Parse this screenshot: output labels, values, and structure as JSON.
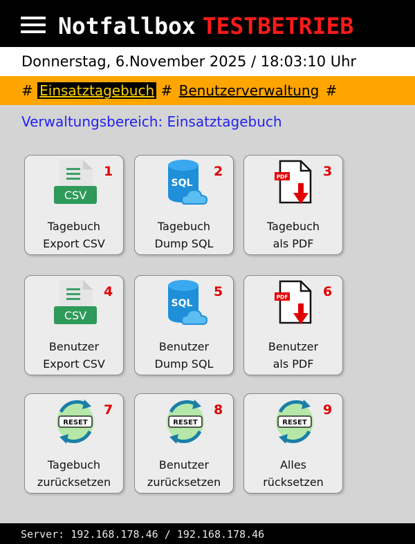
{
  "header": {
    "app_title": "Notfallbox",
    "mode_badge": "TESTBETRIEB"
  },
  "datebar": {
    "datetime": "Donnerstag, 6.November 2025 / 18:03:10 Uhr"
  },
  "nav": {
    "sep": "#",
    "items": [
      {
        "label": "Einsatztagebuch",
        "active": true
      },
      {
        "label": "Benutzerverwaltung",
        "active": false
      }
    ]
  },
  "area_title": "Verwaltungsbereich: Einsatztagebuch",
  "tiles": [
    {
      "num": "1",
      "icon": "csv-file-icon",
      "label": "Tagebuch\nExport CSV",
      "icon_text": "CSV"
    },
    {
      "num": "2",
      "icon": "sql-database-icon",
      "label": "Tagebuch\nDump SQL",
      "icon_text": "SQL"
    },
    {
      "num": "3",
      "icon": "pdf-download-icon",
      "label": "Tagebuch\nals PDF",
      "icon_text": "PDF"
    },
    {
      "num": "4",
      "icon": "csv-file-icon",
      "label": "Benutzer\nExport CSV",
      "icon_text": "CSV"
    },
    {
      "num": "5",
      "icon": "sql-database-icon",
      "label": "Benutzer\nDump SQL",
      "icon_text": "SQL"
    },
    {
      "num": "6",
      "icon": "pdf-download-icon",
      "label": "Benutzer\nals PDF",
      "icon_text": "PDF"
    },
    {
      "num": "7",
      "icon": "reset-icon",
      "label": "Tagebuch\nzurücksetzen",
      "icon_text": "RESET"
    },
    {
      "num": "8",
      "icon": "reset-icon",
      "label": "Benutzer\nzurücksetzen",
      "icon_text": "RESET"
    },
    {
      "num": "9",
      "icon": "reset-icon",
      "label": "Alles\nrücksetzen",
      "icon_text": "RESET"
    }
  ],
  "footer": {
    "server": "Server: 192.168.178.46 / 192.168.178.46"
  },
  "colors": {
    "header_bg": "#000000",
    "mode_badge": "#ff1a1a",
    "nav_bg": "#ffa500",
    "area_title": "#2222ee",
    "tile_number": "#e00000",
    "csv_green": "#2e9a5a",
    "sql_blue": "#1e8fd8",
    "pdf_red": "#e00000",
    "reset_green": "#b5e8a8"
  }
}
